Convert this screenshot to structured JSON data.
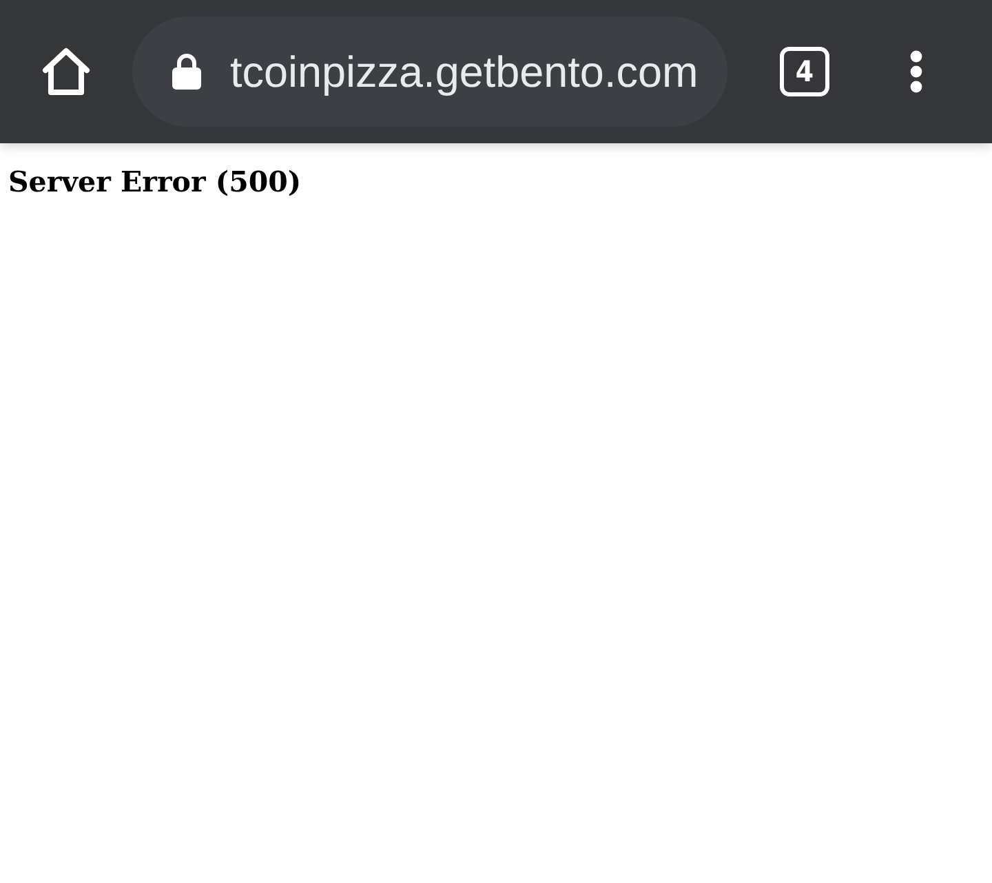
{
  "toolbar": {
    "url": "tcoinpizza.getbento.com",
    "tab_count": "4"
  },
  "page": {
    "heading": "Server Error (500)"
  }
}
